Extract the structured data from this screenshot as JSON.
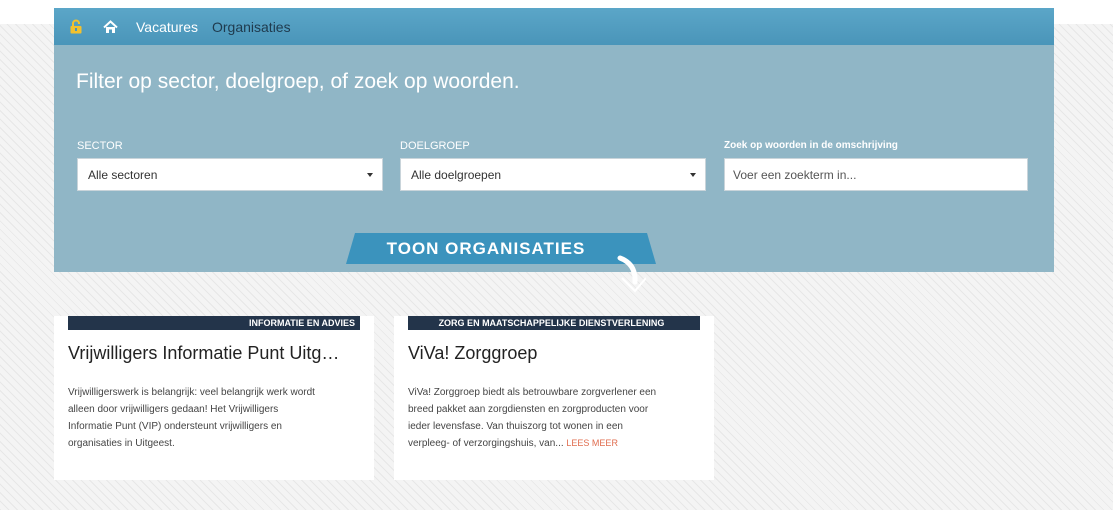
{
  "nav": {
    "links": [
      "Vacatures",
      "Organisaties"
    ],
    "active": "Organisaties"
  },
  "filter": {
    "headline": "Filter op sector, doelgroep, of zoek op woorden.",
    "sector": {
      "label": "SECTOR",
      "value": "Alle sectoren"
    },
    "doelgroep": {
      "label": "DOELGROEP",
      "value": "Alle doelgroepen"
    },
    "search": {
      "label": "Zoek op woorden in de omschrijving",
      "placeholder": "Voer een zoekterm in..."
    },
    "button_label": "TOON ORGANISATIES"
  },
  "cards": [
    {
      "badge": "INFORMATIE EN ADVIES",
      "title": "Vrijwilligers Informatie Punt Uitg…",
      "body": [
        "Vrijwilligerswerk is belangrijk: veel belangrijk werk wordt",
        "alleen door vrijwilligers gedaan! Het Vrijwilligers",
        "Informatie Punt (VIP) ondersteunt vrijwilligers en",
        "organisaties in Uitgeest."
      ]
    },
    {
      "badge": "ZORG EN MAATSCHAPPELIJKE DIENSTVERLENING",
      "title": "ViVa! Zorggroep",
      "body": [
        "ViVa! Zorggroep biedt als betrouwbare zorgverlener een",
        "breed pakket aan zorgdiensten en zorgproducten voor",
        "ieder levensfase. Van thuiszorg tot wonen in een",
        "verpleeg- of verzorgingshuis, van..."
      ],
      "more": "LEES MEER"
    }
  ],
  "colors": {
    "navbar": "#4a95b9",
    "panel": "#90b6c6",
    "button": "#3b93bd",
    "badge": "#23344a",
    "accent": "#e06d4f"
  },
  "icons": [
    "lock-icon",
    "home-icon",
    "arrow-down-icon"
  ]
}
